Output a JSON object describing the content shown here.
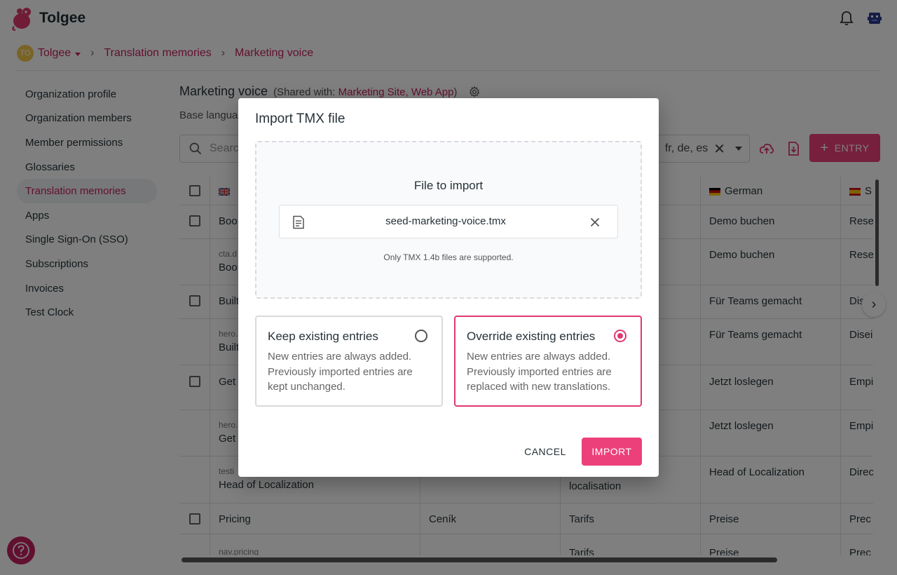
{
  "app": {
    "name": "Tolgee"
  },
  "breadcrumb": {
    "org_initials": "TO",
    "org_name": "Tolgee",
    "section": "Translation memories",
    "current": "Marketing voice"
  },
  "sidebar": {
    "items": [
      {
        "label": "Organization profile"
      },
      {
        "label": "Organization members"
      },
      {
        "label": "Member permissions"
      },
      {
        "label": "Glossaries"
      },
      {
        "label": "Translation memories",
        "active": true
      },
      {
        "label": "Apps"
      },
      {
        "label": "Single Sign-On (SSO)"
      },
      {
        "label": "Subscriptions"
      },
      {
        "label": "Invoices"
      },
      {
        "label": "Test Clock"
      }
    ]
  },
  "main": {
    "title": "Marketing voice",
    "shared_prefix": "(Shared with:",
    "shared_with": "Marketing Site, Web App",
    "shared_suffix": ")",
    "base_language": "Base langua",
    "search_placeholder": "Search",
    "languages_value": "fr, de, es",
    "entry_button": "ENTRY"
  },
  "table": {
    "headers": {
      "german": "German"
    },
    "rows": [
      {
        "c1": "Boo",
        "c3": "o",
        "c4": "Demo buchen",
        "c5": "Rese"
      },
      {
        "key": "cta.d",
        "c1": "Boo",
        "c3": "o",
        "c4": "Demo buchen",
        "c5": "Rese"
      },
      {
        "c1": "Built",
        "c3": "uipes",
        "c4": "Für Teams gemacht",
        "c5": "Dis"
      },
      {
        "key": "hero.",
        "c1": "Built",
        "c3": "uipes",
        "c4": "Für Teams gemacht",
        "c5": "Disei"
      },
      {
        "c1": "Get",
        "c4": "Jetzt loslegen",
        "c5": "Empi"
      },
      {
        "key": "hero.",
        "c1": "Get",
        "c4": "Jetzt loslegen",
        "c5": "Empi"
      },
      {
        "key": "testi",
        "c1": "Head of Localization",
        "c3": "localisation",
        "c4": "Head of Localization",
        "c5": "Direc"
      },
      {
        "c1": "Pricing",
        "c2": "Ceník",
        "c3": "Tarifs",
        "c4": "Preise",
        "c5": "Prec"
      },
      {
        "key": "nav.pricing",
        "c3": "Tarifs",
        "c4": "Preise",
        "c5": "Prec"
      }
    ]
  },
  "dialog": {
    "title": "Import TMX file",
    "file_label": "File to import",
    "file_name": "seed-marketing-voice.tmx",
    "hint": "Only TMX 1.4b files are supported.",
    "option_keep": {
      "title": "Keep existing entries",
      "desc": "New entries are always added. Previously imported entries are kept unchanged.",
      "selected": false
    },
    "option_override": {
      "title": "Override existing entries",
      "desc": "New entries are always added. Previously imported entries are replaced with new translations.",
      "selected": true
    },
    "cancel_label": "CANCEL",
    "import_label": "IMPORT"
  },
  "colors": {
    "accent": "#ec407a",
    "link": "#c5205e"
  }
}
